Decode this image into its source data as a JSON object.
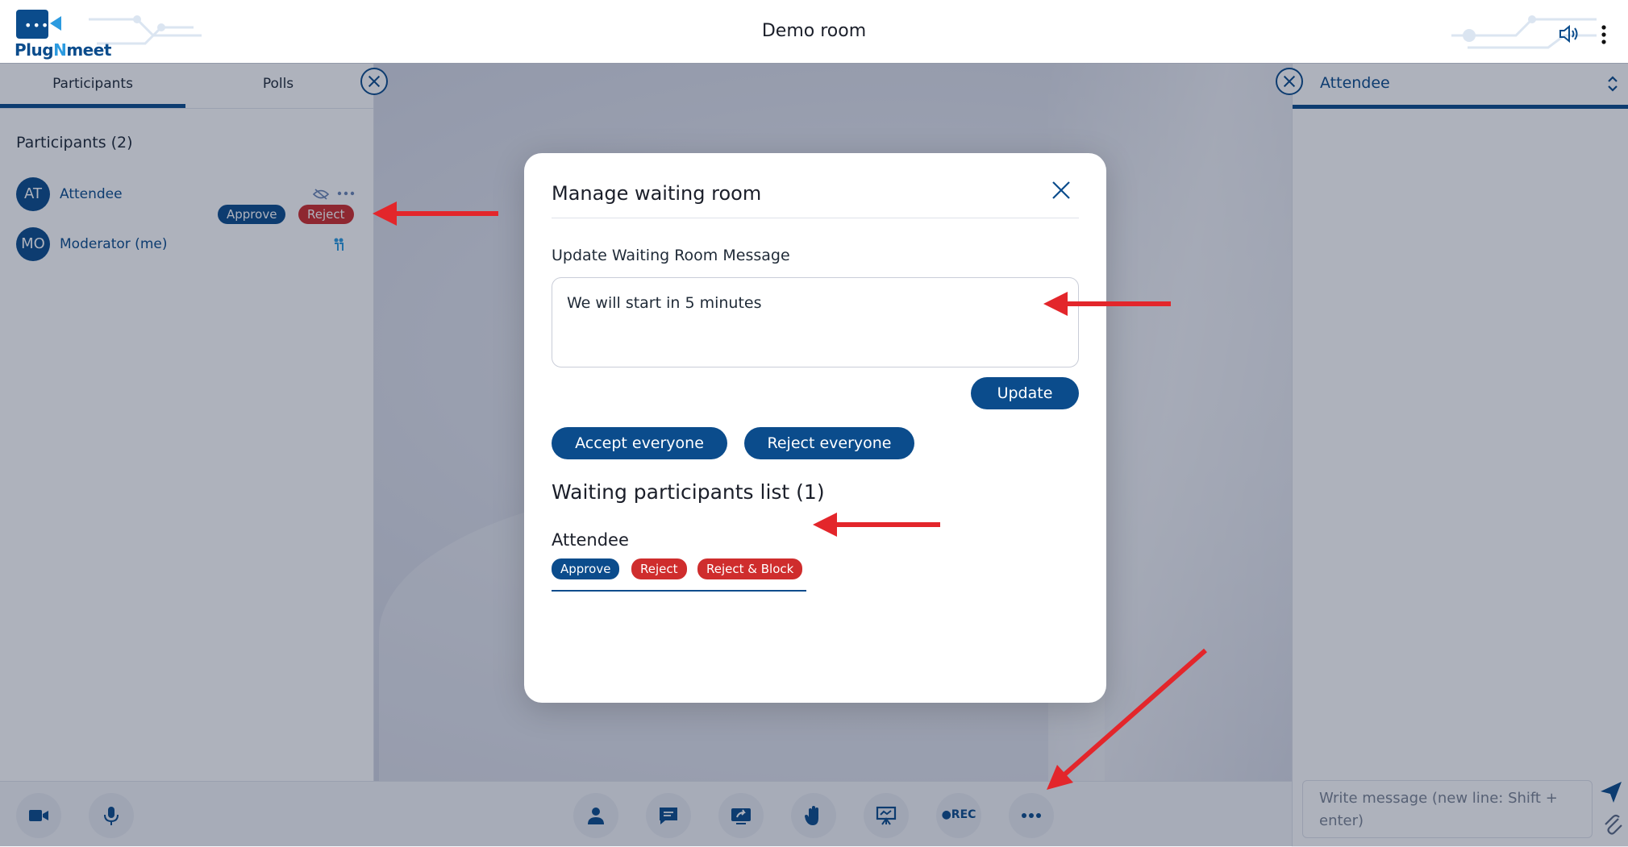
{
  "app": {
    "logo_text_dark": "lug",
    "logo_text_n": "N",
    "logo_text_rest": "meet",
    "logo_letter": "P",
    "room_title": "Demo room"
  },
  "sidebar": {
    "tabs": [
      {
        "label": "Participants",
        "active": true
      },
      {
        "label": "Polls",
        "active": false
      }
    ],
    "participants_title": "Participants (2)",
    "participants": [
      {
        "initials": "AT",
        "name": "Attendee",
        "approve_label": "Approve",
        "reject_label": "Reject"
      },
      {
        "initials": "MO",
        "name": "Moderator (me)"
      }
    ]
  },
  "right_panel": {
    "title": "Attendee",
    "chat_placeholder": "Write message (new line: Shift + enter)"
  },
  "toolbar": {
    "buttons": [
      {
        "icon": "camera-icon"
      },
      {
        "icon": "microphone-icon"
      },
      {
        "icon": "participants-icon"
      },
      {
        "icon": "chat-icon"
      },
      {
        "icon": "share-screen-icon"
      },
      {
        "icon": "raise-hand-icon"
      },
      {
        "icon": "whiteboard-icon"
      },
      {
        "icon": "record-icon",
        "label": "●REC"
      },
      {
        "icon": "more-icon"
      }
    ]
  },
  "modal": {
    "title": "Manage waiting room",
    "message_label": "Update Waiting Room Message",
    "message_value": "We will start in 5 minutes",
    "update_button": "Update",
    "accept_everyone": "Accept everyone",
    "reject_everyone": "Reject everyone",
    "waiting_title": "Waiting participants list (1)",
    "waiting": [
      {
        "name": "Attendee",
        "approve": "Approve",
        "reject": "Reject",
        "reject_block": "Reject & Block"
      }
    ]
  },
  "colors": {
    "primary": "#0b4c8c",
    "danger": "#cf2d2d",
    "annotation": "#e3262b"
  }
}
